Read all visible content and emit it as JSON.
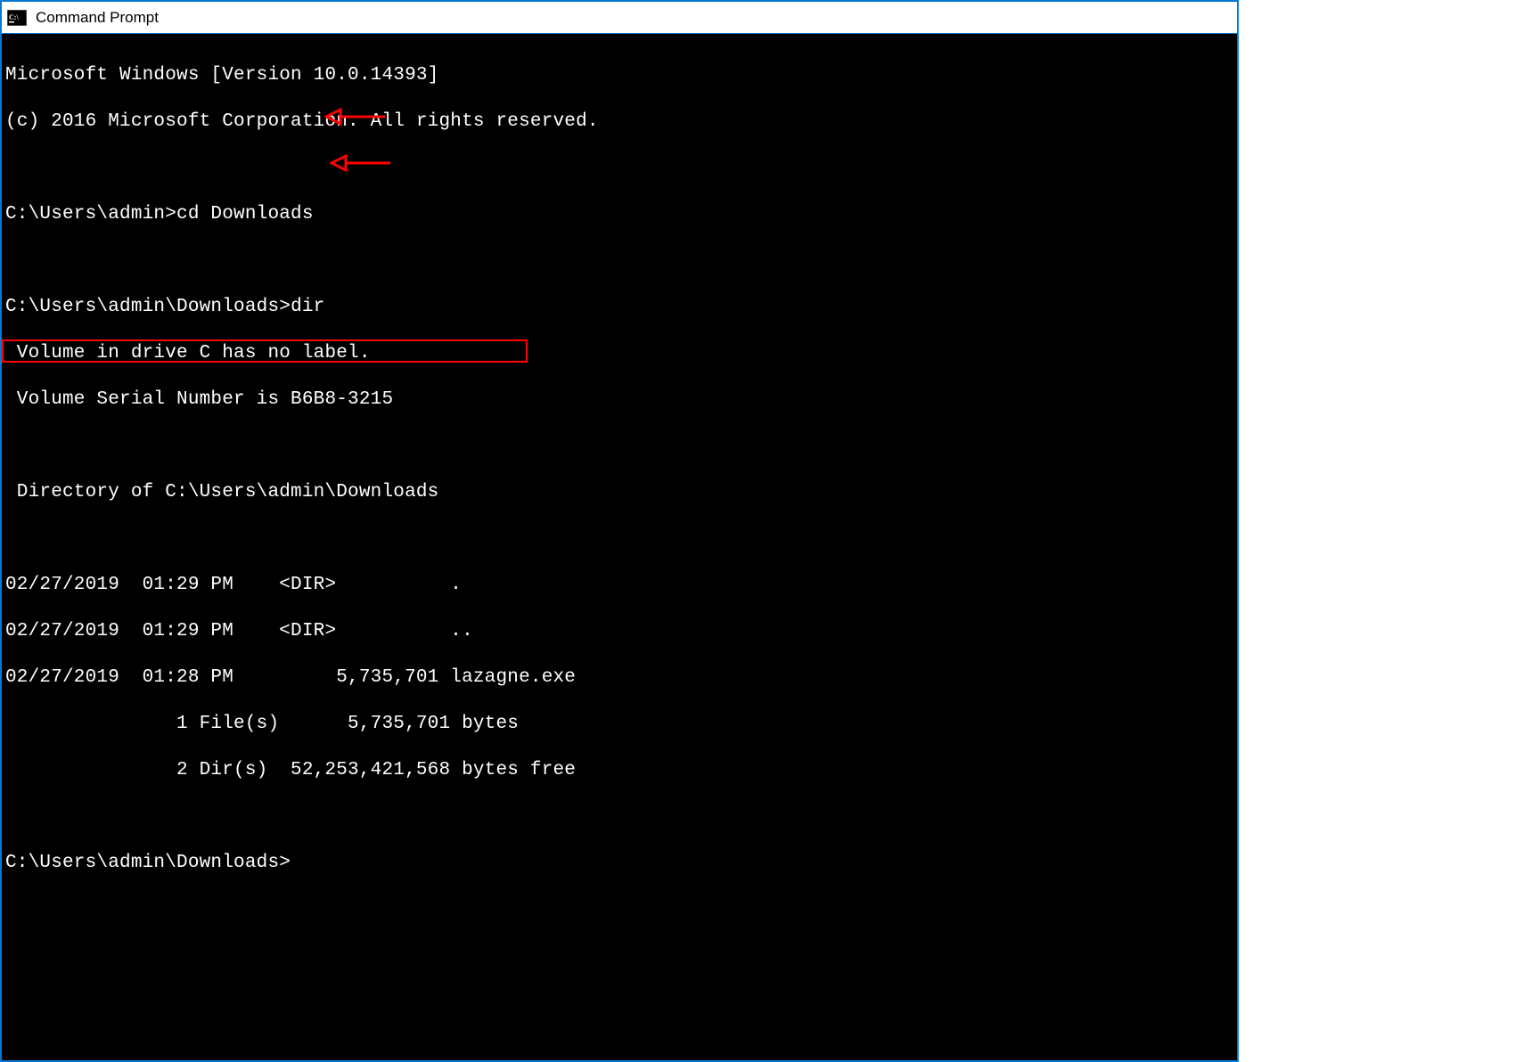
{
  "window": {
    "title": "Command Prompt"
  },
  "terminal": {
    "banner_line1": "Microsoft Windows [Version 10.0.14393]",
    "banner_line2": "(c) 2016 Microsoft Corporation. All rights reserved.",
    "prompt1_path": "C:\\Users\\admin>",
    "prompt1_cmd": "cd Downloads",
    "prompt2_path": "C:\\Users\\admin\\Downloads>",
    "prompt2_cmd": "dir",
    "dir_volume": " Volume in drive C has no label.",
    "dir_serial": " Volume Serial Number is B6B8-3215",
    "dir_header": " Directory of C:\\Users\\admin\\Downloads",
    "dir_entry1": "02/27/2019  01:29 PM    <DIR>          .",
    "dir_entry2": "02/27/2019  01:29 PM    <DIR>          ..",
    "dir_entry3": "02/27/2019  01:28 PM         5,735,701 lazagne.exe",
    "dir_summary1": "               1 File(s)      5,735,701 bytes",
    "dir_summary2": "               2 Dir(s)  52,253,421,568 bytes free",
    "prompt3_path": "C:\\Users\\admin\\Downloads>",
    "prompt3_cmd": ""
  }
}
